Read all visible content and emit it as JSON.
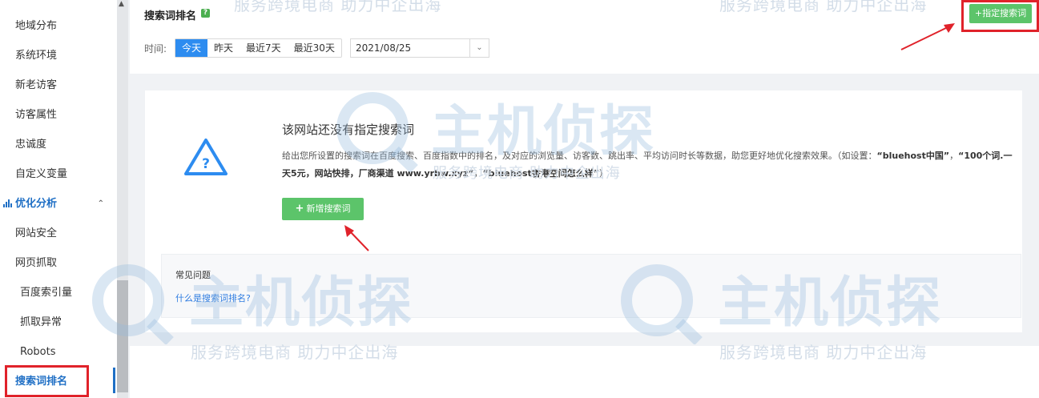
{
  "sidebar": {
    "items": [
      {
        "label": "地域分布"
      },
      {
        "label": "系统环境"
      },
      {
        "label": "新老访客"
      },
      {
        "label": "访客属性"
      },
      {
        "label": "忠诚度"
      },
      {
        "label": "自定义变量"
      }
    ],
    "group": {
      "label": "优化分析",
      "icon": "bar-chart-icon",
      "chevron": "chevron-up-icon"
    },
    "sub_items": [
      {
        "label": "网站安全"
      },
      {
        "label": "网页抓取"
      },
      {
        "label": "百度索引量"
      },
      {
        "label": "抓取异常"
      },
      {
        "label": "Robots"
      },
      {
        "label": "搜索词排名"
      }
    ],
    "active_item": "搜索词排名"
  },
  "header": {
    "title": "搜索词排名",
    "help_badge": "?",
    "time_label": "时间:",
    "time_options": [
      "今天",
      "昨天",
      "最近7天",
      "最近30天"
    ],
    "active_time_option": "今天",
    "date_value": "2021/08/25",
    "assign_button": "+指定搜索词"
  },
  "empty_state": {
    "icon": "warning-triangle-icon",
    "title": "该网站还没有指定搜索词",
    "desc_1": "给出您所设置的搜索词在百度搜索、百度指数中的排名，及对应的浏览量、访客数、跳出率、平均访问时长等数据，助您更好地优化搜索效果。（如设置：",
    "desc_b1": "“bluehost中国”",
    "desc_2": "，",
    "desc_b2": "“100个词.一天5元，网站快排，厂商渠道 www.yrbw.xyz”",
    "desc_3": "，",
    "desc_b3": "“bluehost香港空间怎么样”",
    "desc_4": "）",
    "add_button_plus": "+",
    "add_button_label": "新增搜索词"
  },
  "faq": {
    "title": "常见问题",
    "link": "什么是搜索词排名?"
  },
  "watermark": {
    "brand": "主机侦探",
    "slogan": "服务跨境电商 助力中企出海"
  },
  "colors": {
    "accent": "#2d8cf0",
    "green": "#5cc46a",
    "highlight": "#e0222a",
    "link": "#2d7be0"
  }
}
